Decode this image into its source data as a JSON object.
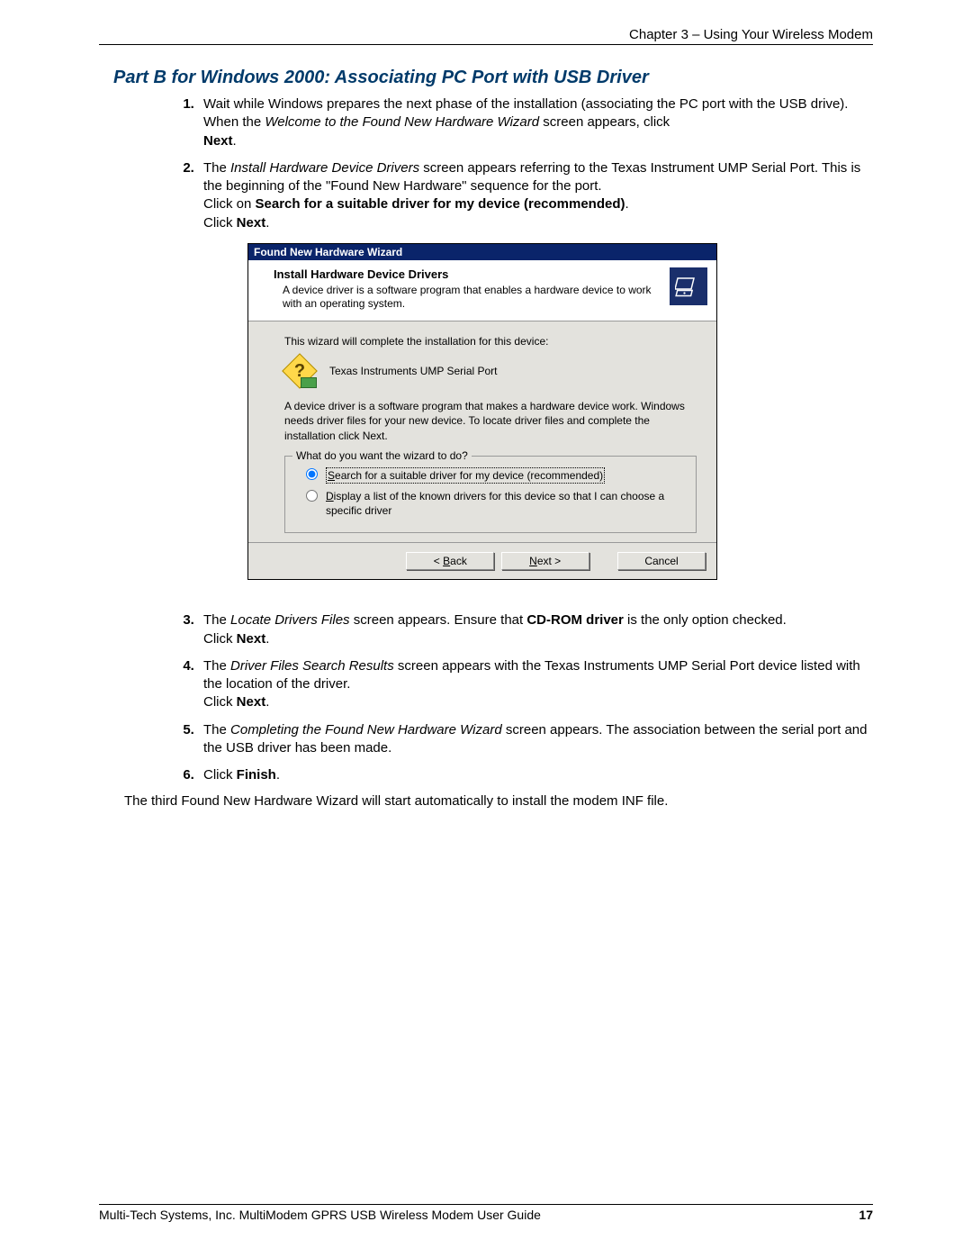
{
  "header": {
    "chapter": "Chapter 3 – Using Your Wireless Modem"
  },
  "section_title": "Part B for Windows 2000: Associating PC Port with USB Driver",
  "steps": {
    "s1": {
      "a": "Wait while Windows prepares the next phase of the installation (associating the PC port with the USB drive). When the ",
      "b": "Welcome to the Found New Hardware Wizard",
      "c": " screen appears, click ",
      "d": "Next",
      "e": "."
    },
    "s2": {
      "a": "The ",
      "b": "Install Hardware Device Drivers",
      "c": " screen appears referring to the Texas Instrument UMP Serial Port. This is the beginning of the \"Found New Hardware\" sequence for the port.",
      "d": "Click on ",
      "e": "Search for a suitable driver for my device (recommended)",
      "f": ".",
      "g": "Click ",
      "h": "Next",
      "i": "."
    },
    "s3": {
      "a": "The ",
      "b": "Locate Drivers Files",
      "c": " screen appears. Ensure that ",
      "d": "CD-ROM driver",
      "e": " is the only option checked.",
      "f": "Click ",
      "g": "Next",
      "h": "."
    },
    "s4": {
      "a": "The ",
      "b": "Driver Files Search Results",
      "c": " screen appears with the Texas Instruments UMP Serial Port device listed with the location of the driver.",
      "d": "Click ",
      "e": "Next",
      "f": "."
    },
    "s5": {
      "a": "The ",
      "b": "Completing the Found New Hardware Wizard",
      "c": " screen appears. The association between the serial port and the USB driver has been made."
    },
    "s6": {
      "a": "Click ",
      "b": "Finish",
      "c": "."
    }
  },
  "wizard": {
    "title": "Found New Hardware Wizard",
    "header_title": "Install Hardware Device Drivers",
    "header_sub": "A device driver is a software program that enables a hardware device to work with an operating system.",
    "intro": "This wizard will complete the installation for this device:",
    "device": "Texas Instruments UMP Serial Port",
    "explain": "A device driver is a software program that makes a hardware device work. Windows needs driver files for your new device. To locate driver files and complete the installation click Next.",
    "group_legend": "What do you want the wizard to do?",
    "opt1_pre": "S",
    "opt1_rest": "earch for a suitable driver for my device (recommended)",
    "opt2_pre": "D",
    "opt2_rest": "isplay a list of the known drivers for this device so that I can choose a specific driver",
    "back_pre": "< ",
    "back_u": "B",
    "back_rest": "ack",
    "next_u": "N",
    "next_rest": "ext >",
    "cancel": "Cancel"
  },
  "closing": "The third Found New Hardware Wizard will start automatically to install the modem INF file.",
  "footer": {
    "text": "Multi-Tech Systems, Inc. MultiModem GPRS USB Wireless Modem User Guide",
    "page": "17"
  }
}
